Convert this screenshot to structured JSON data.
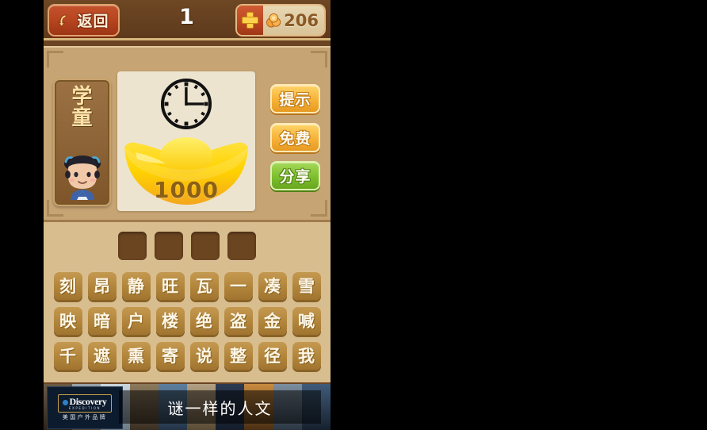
{
  "topbar": {
    "back_label": "返回",
    "back_icon": "back-arrow-icon",
    "level": "1",
    "plus_icon": "plus-icon",
    "coin_icon": "coin-icon",
    "coin_count": "206"
  },
  "panel": {
    "rank_char_1": "学",
    "rank_char_2": "童",
    "avatar_icon": "scholar-avatar-icon",
    "clock_icon": "clock-icon",
    "ingot_icon": "gold-ingot-icon",
    "ingot_value": "1000",
    "buttons": [
      {
        "label": "提示",
        "style": "orange",
        "name": "hint-button"
      },
      {
        "label": "免费",
        "style": "orange",
        "name": "free-button"
      },
      {
        "label": "分享",
        "style": "green",
        "name": "share-button"
      }
    ]
  },
  "answer_slots": [
    "",
    "",
    "",
    ""
  ],
  "keyboard": {
    "rows": [
      [
        "刻",
        "昂",
        "静",
        "旺",
        "瓦",
        "一",
        "凑",
        "雪"
      ],
      [
        "映",
        "暗",
        "户",
        "楼",
        "绝",
        "盗",
        "金",
        "喊"
      ],
      [
        "千",
        "遮",
        "熏",
        "寄",
        "说",
        "整",
        "径",
        "我"
      ]
    ]
  },
  "ad": {
    "brand": "Discovery",
    "brand_sub": "EXPEDITION",
    "brand_cn": "美国户外品牌",
    "headline": "谜一样的人文"
  },
  "colors": {
    "bg_outside": "#000000",
    "topbar": "#5e3a1c",
    "panel": "#c7a473",
    "lower": "#d8bd8e",
    "card": "#ece4cf",
    "key": "#b2853c",
    "slot": "#6b4420",
    "orange_button": "#f6b33a",
    "green_button": "#7fc02f",
    "back_button": "#b4431f",
    "ingot": "#ffd400",
    "ad_bg": "#14243a"
  }
}
